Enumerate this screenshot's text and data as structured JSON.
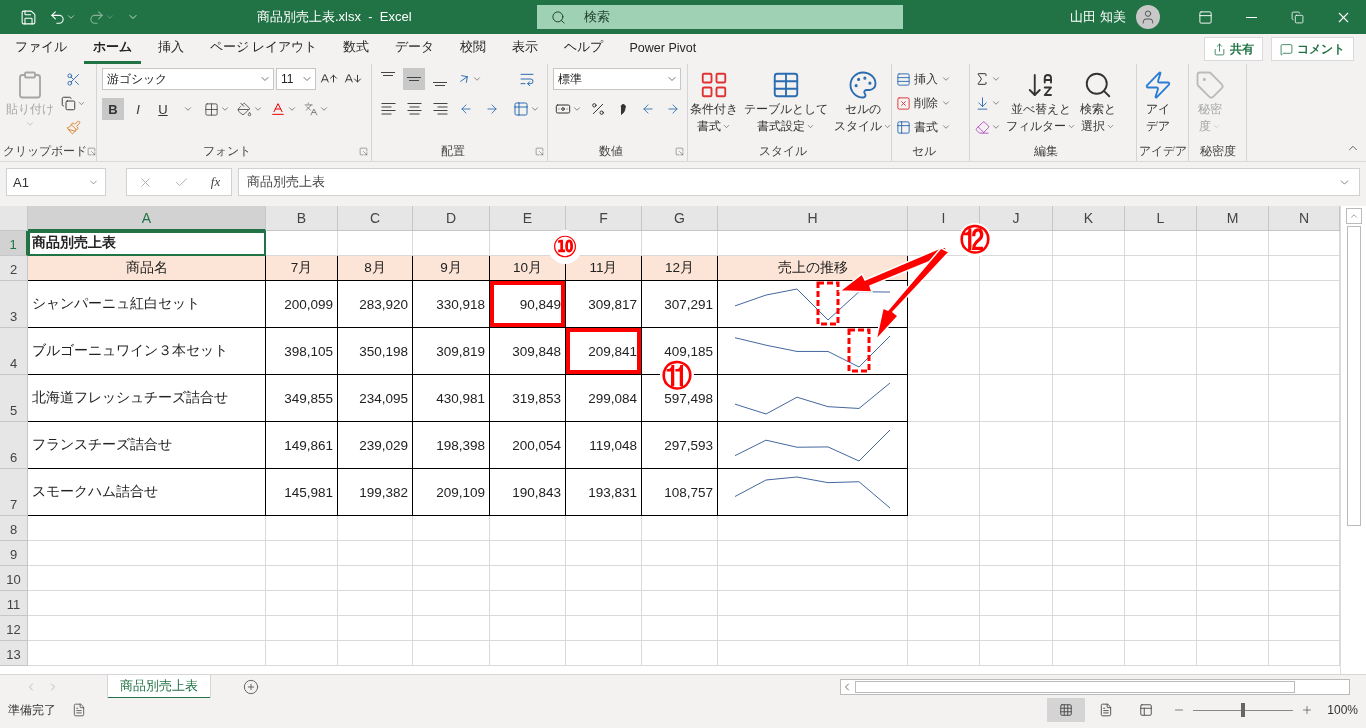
{
  "title_bar": {
    "file_title": "商品別売上表.xlsx  -  Excel",
    "search_placeholder": "検索",
    "user": "山田 知美"
  },
  "menu_tabs": [
    {
      "label": "ファイル",
      "selected": false
    },
    {
      "label": "ホーム",
      "selected": true
    },
    {
      "label": "挿入",
      "selected": false
    },
    {
      "label": "ページ レイアウト",
      "selected": false
    },
    {
      "label": "数式",
      "selected": false
    },
    {
      "label": "データ",
      "selected": false
    },
    {
      "label": "校閲",
      "selected": false
    },
    {
      "label": "表示",
      "selected": false
    },
    {
      "label": "ヘルプ",
      "selected": false
    },
    {
      "label": "Power Pivot",
      "selected": false
    }
  ],
  "share_button": "共有",
  "comment_button": "コメント",
  "ribbon": {
    "clipboard": {
      "paste": "貼り付け",
      "label": "クリップボード"
    },
    "font": {
      "name": "游ゴシック",
      "size": "11",
      "label": "フォント",
      "styles": [
        {
          "label": "B",
          "selected": true
        },
        {
          "label": "I",
          "selected": false
        },
        {
          "label": "U",
          "selected": false
        }
      ]
    },
    "alignment": {
      "label": "配置",
      "vertical": [
        {
          "selected": false
        },
        {
          "selected": true
        },
        {
          "selected": false
        }
      ]
    },
    "number": {
      "format": "標準",
      "label": "数値"
    },
    "styles": {
      "label": "スタイル",
      "buttons": [
        {
          "lines": [
            "条件付き",
            "書式"
          ]
        },
        {
          "lines": [
            "テーブルとして",
            "書式設定"
          ]
        },
        {
          "lines": [
            "セルの",
            "スタイル"
          ]
        }
      ]
    },
    "cells": {
      "label": "セル",
      "buttons": [
        "挿入",
        "削除",
        "書式"
      ]
    },
    "editing": {
      "label": "編集",
      "buttons": [
        {
          "lines": [
            "並べ替えと",
            "フィルター"
          ]
        },
        {
          "lines": [
            "検索と",
            "選択"
          ]
        }
      ]
    },
    "ideas": {
      "label": "アイデア",
      "button": [
        "アイ",
        "デア"
      ]
    },
    "sensitivity": {
      "label": "秘密度",
      "button": [
        "秘密",
        "度"
      ],
      "disabled": true
    }
  },
  "formula_bar": {
    "name_box": "A1",
    "fx": "fx",
    "formula": "商品別売上表"
  },
  "sheet": {
    "columns": [
      {
        "label": "A",
        "selected": true
      },
      {
        "label": "B",
        "selected": false
      },
      {
        "label": "C",
        "selected": false
      },
      {
        "label": "D",
        "selected": false
      },
      {
        "label": "E",
        "selected": false
      },
      {
        "label": "F",
        "selected": false
      },
      {
        "label": "G",
        "selected": false
      },
      {
        "label": "H",
        "selected": false
      },
      {
        "label": "I",
        "selected": false
      },
      {
        "label": "J",
        "selected": false
      },
      {
        "label": "K",
        "selected": false
      },
      {
        "label": "L",
        "selected": false
      },
      {
        "label": "M",
        "selected": false
      },
      {
        "label": "N",
        "selected": false
      }
    ],
    "rows": [
      {
        "kind": "title",
        "label": "1",
        "selected": true,
        "title": "商品別売上表"
      },
      {
        "kind": "header",
        "label": "2",
        "selected": false,
        "cells": [
          "商品名",
          "7月",
          "8月",
          "9月",
          "10月",
          "11月",
          "12月",
          "売上の推移"
        ]
      },
      {
        "kind": "data",
        "label": "3",
        "selected": false,
        "product": "シャンパーニュ紅白セット",
        "values": [
          {
            "text": "200,099",
            "marked": false
          },
          {
            "text": "283,920",
            "marked": false
          },
          {
            "text": "330,918",
            "marked": false
          },
          {
            "text": "90,849",
            "marked": true
          },
          {
            "text": "309,817",
            "marked": false
          },
          {
            "text": "307,291",
            "marked": false
          }
        ]
      },
      {
        "kind": "data",
        "label": "4",
        "selected": false,
        "product": "ブルゴーニュワイン３本セット",
        "values": [
          {
            "text": "398,105",
            "marked": false
          },
          {
            "text": "350,198",
            "marked": false
          },
          {
            "text": "309,819",
            "marked": false
          },
          {
            "text": "309,848",
            "marked": false
          },
          {
            "text": "209,841",
            "marked": true
          },
          {
            "text": "409,185",
            "marked": false
          }
        ]
      },
      {
        "kind": "data",
        "label": "5",
        "selected": false,
        "product": "北海道フレッシュチーズ詰合せ",
        "values": [
          {
            "text": "349,855",
            "marked": false
          },
          {
            "text": "234,095",
            "marked": false
          },
          {
            "text": "430,981",
            "marked": false
          },
          {
            "text": "319,853",
            "marked": false
          },
          {
            "text": "299,084",
            "marked": false
          },
          {
            "text": "597,498",
            "marked": false
          }
        ]
      },
      {
        "kind": "data",
        "label": "6",
        "selected": false,
        "product": "フランスチーズ詰合せ",
        "values": [
          {
            "text": "149,861",
            "marked": false
          },
          {
            "text": "239,029",
            "marked": false
          },
          {
            "text": "198,398",
            "marked": false
          },
          {
            "text": "200,054",
            "marked": false
          },
          {
            "text": "119,048",
            "marked": false
          },
          {
            "text": "297,593",
            "marked": false
          }
        ]
      },
      {
        "kind": "data",
        "label": "7",
        "selected": false,
        "product": "スモークハム詰合せ",
        "values": [
          {
            "text": "145,981",
            "marked": false
          },
          {
            "text": "199,382",
            "marked": false
          },
          {
            "text": "209,109",
            "marked": false
          },
          {
            "text": "190,843",
            "marked": false
          },
          {
            "text": "193,831",
            "marked": false
          },
          {
            "text": "108,757",
            "marked": false
          }
        ]
      },
      {
        "kind": "empty",
        "label": "8",
        "selected": false
      },
      {
        "kind": "empty",
        "label": "9",
        "selected": false
      },
      {
        "kind": "empty",
        "label": "10",
        "selected": false
      },
      {
        "kind": "empty",
        "label": "11",
        "selected": false
      },
      {
        "kind": "empty",
        "label": "12",
        "selected": false
      },
      {
        "kind": "empty",
        "label": "13",
        "selected": false
      }
    ]
  },
  "callouts": [
    {
      "label": "⑩"
    },
    {
      "label": "⑪"
    },
    {
      "label": "⑫"
    }
  ],
  "sheet_tabs": [
    {
      "label": "商品別売上表",
      "selected": true
    }
  ],
  "status_bar": {
    "status": "準備完了",
    "zoom": "100%",
    "zoom_level": {
      "level": 0.5
    }
  }
}
